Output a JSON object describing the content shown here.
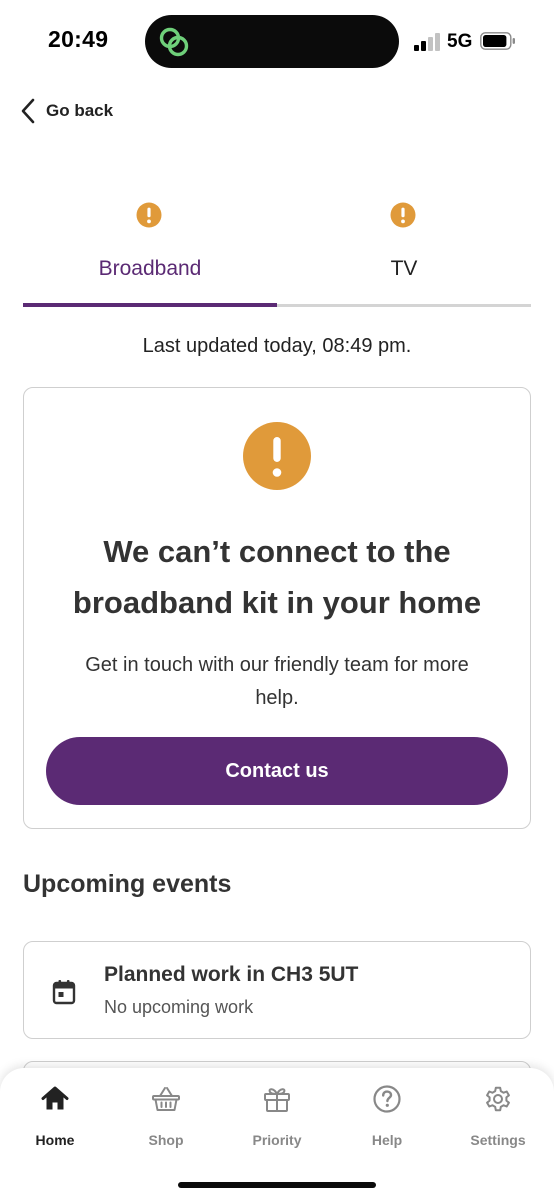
{
  "status_bar": {
    "time": "20:49",
    "network": "5G",
    "signal_bars_active": 2,
    "signal_bars_total": 4,
    "battery_level": 0.9,
    "island_icon": "linked-rings-icon"
  },
  "header": {
    "back_label": "Go back",
    "back_icon": "chevron-left-icon"
  },
  "tabs": [
    {
      "label": "Broadband",
      "selected": true,
      "status_icon": "alert-icon"
    },
    {
      "label": "TV",
      "selected": false,
      "status_icon": "alert-icon"
    }
  ],
  "last_updated": "Last updated today, 08:49 pm.",
  "alert_card": {
    "icon": "exclamation-circle-icon",
    "title_line1": "We can’t connect to the",
    "title_line2": "broadband kit in your home",
    "body_line1": "Get in touch with our friendly team for more",
    "body_line2": "help.",
    "button_label": "Contact us"
  },
  "upcoming": {
    "section_title": "Upcoming events",
    "events": [
      {
        "icon": "calendar-icon",
        "title": "Planned work in CH3 5UT",
        "subtitle": "No upcoming work"
      }
    ]
  },
  "bottom_nav": [
    {
      "label": "Home",
      "icon": "home-icon",
      "active": true
    },
    {
      "label": "Shop",
      "icon": "basket-icon",
      "active": false
    },
    {
      "label": "Priority",
      "icon": "gift-icon",
      "active": false
    },
    {
      "label": "Help",
      "icon": "help-circle-icon",
      "active": false
    },
    {
      "label": "Settings",
      "icon": "gear-icon",
      "active": false
    }
  ],
  "colors": {
    "brand": "#5b2a74",
    "warning": "#e09a3a",
    "text": "#333333",
    "border": "#cfcfcf"
  }
}
